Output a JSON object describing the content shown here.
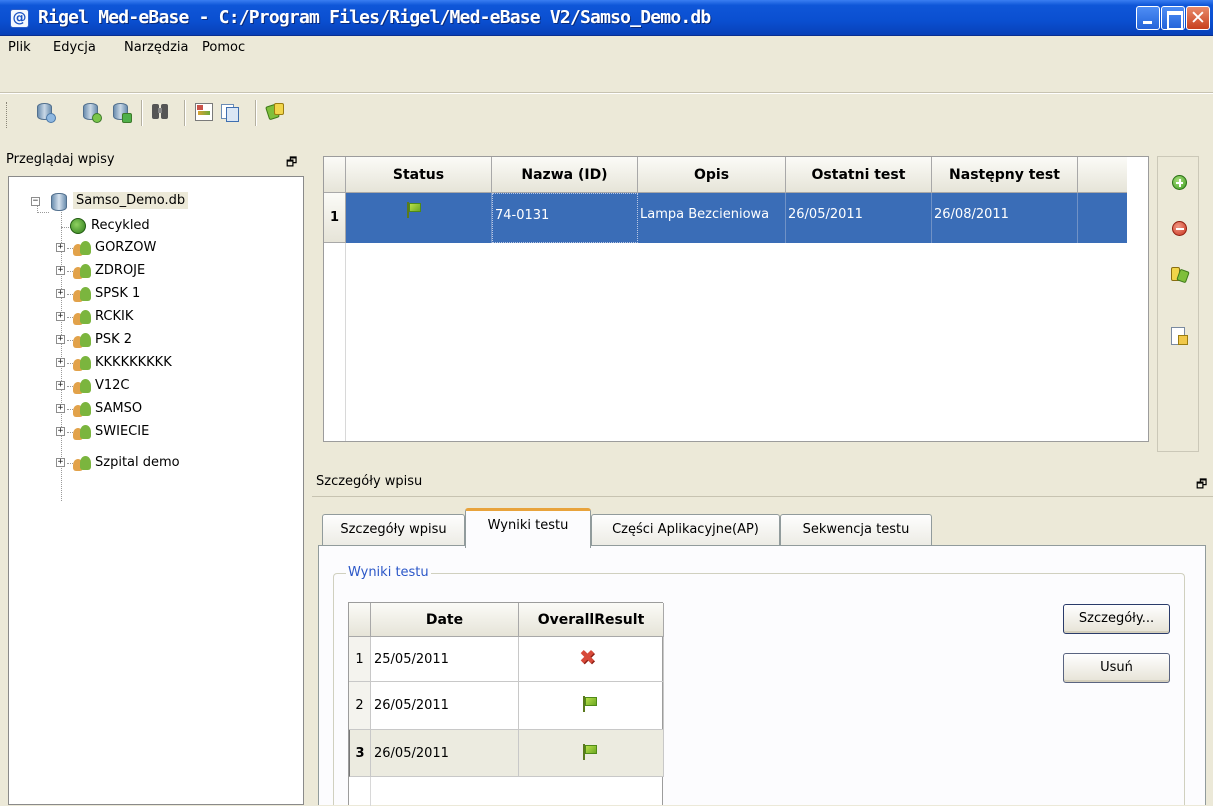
{
  "window": {
    "title": "Rigel Med-eBase - C:/Program Files/Rigel/Med-eBase V2/Samso_Demo.db",
    "app_icon_glyph": "@",
    "close_glyph": "✕"
  },
  "menu": {
    "items": [
      "Plik",
      "Edycja",
      "Narzędzia",
      "Pomoc"
    ]
  },
  "toolbar": {
    "icons": [
      "database-icon",
      "database-add-icon",
      "database-export-icon",
      "binoculars-icon",
      "report-icon",
      "copy-records-icon",
      "sync-icon"
    ]
  },
  "tree_panel": {
    "title": "Przeglądaj wpisy",
    "float_glyph": "🗗",
    "root": "Samso_Demo.db",
    "recycle": "Recykled",
    "groups": [
      "GORZOW",
      "ZDROJE",
      "SPSK 1",
      "RCKIK",
      "PSK 2",
      "KKKKKKKKK",
      "V12C",
      "SAMSO",
      "SWIECIE",
      "Szpital demo"
    ]
  },
  "records": {
    "columns": [
      "Status",
      "Nazwa (ID)",
      "Opis",
      "Ostatni test",
      "Następny test"
    ],
    "rows": [
      {
        "num": "1",
        "status": "green-flag-icon",
        "name": "74-0131",
        "desc": "Lampa Bezcieniowa",
        "last": "26/05/2011",
        "next": "26/08/2011"
      }
    ]
  },
  "side_toolbar": {
    "icons": [
      "add-record-icon",
      "remove-record-icon",
      "transfer-record-icon",
      "record-details-icon"
    ],
    "accent_add": "#4caf2a",
    "accent_remove": "#d9412c"
  },
  "details": {
    "title": "Szczegóły wpisu",
    "float_glyph": "🗗",
    "tabs": [
      "Szczegóły wpisu",
      "Wyniki testu",
      "Części Aplikacyjne(AP)",
      "Sekwencja testu"
    ],
    "active_tab": "Wyniki testu",
    "group_title": "Wyniki testu",
    "results_columns": [
      "Date",
      "OverallResult"
    ],
    "results": [
      {
        "num": "1",
        "date": "25/05/2011",
        "result": "fail-x-icon"
      },
      {
        "num": "2",
        "date": "26/05/2011",
        "result": "green-flag-icon"
      },
      {
        "num": "3",
        "date": "26/05/2011",
        "result": "green-flag-icon"
      }
    ],
    "details_button": "Szczegóły...",
    "delete_button": "Usuń"
  },
  "colors": {
    "selection": "#3a6db7",
    "titlebar": "#0a4fd0",
    "tab_highlight": "#e8a33c"
  }
}
